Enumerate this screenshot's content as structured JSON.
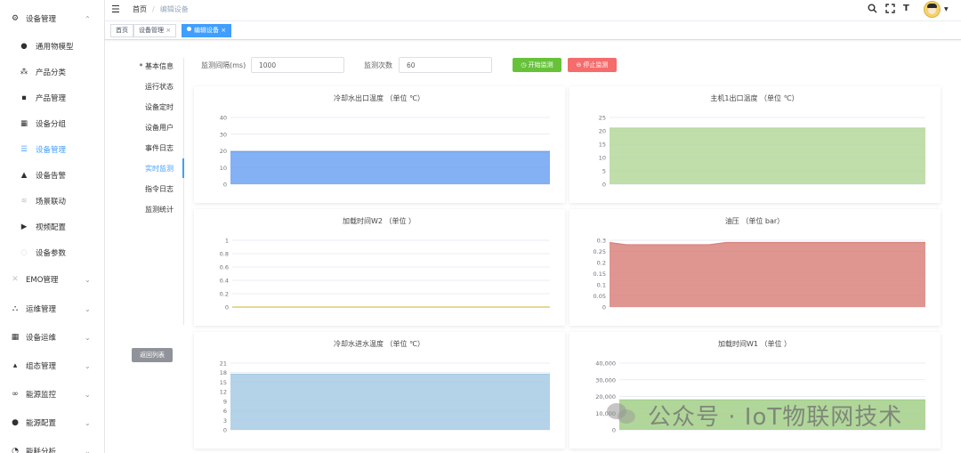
{
  "topbar": {
    "breadcrumb": [
      "首页",
      "编辑设备"
    ],
    "font_size_icon_label": "T"
  },
  "sidebar": {
    "groups": [
      {
        "label": "设备管理",
        "icon": "gear-icon",
        "expanded": true
      },
      {
        "label": "EMO管理",
        "icon": "close-icon"
      },
      {
        "label": "运维管理",
        "icon": "tree-icon"
      },
      {
        "label": "设备运维",
        "icon": "table-icon"
      },
      {
        "label": "组态管理",
        "icon": "lock-icon"
      },
      {
        "label": "能源监控",
        "icon": "link-icon"
      },
      {
        "label": "能源配置",
        "icon": "circle-icon"
      },
      {
        "label": "能耗分析",
        "icon": "chart-icon"
      }
    ],
    "sub_items": [
      {
        "label": "通用物模型",
        "icon": "cube-icon"
      },
      {
        "label": "产品分类",
        "icon": "nodes-icon"
      },
      {
        "label": "产品管理",
        "icon": "grid-icon"
      },
      {
        "label": "设备分组",
        "icon": "table-icon"
      },
      {
        "label": "设备管理",
        "icon": "list-icon",
        "active": true
      },
      {
        "label": "设备告警",
        "icon": "bell-icon"
      },
      {
        "label": "场景联动",
        "icon": "scene-icon"
      },
      {
        "label": "视频配置",
        "icon": "video-icon"
      },
      {
        "label": "设备参数",
        "icon": "param-icon"
      }
    ]
  },
  "tags": [
    {
      "label": "首页"
    },
    {
      "label": "设备管理"
    },
    {
      "label": "编辑设备",
      "active": true
    }
  ],
  "inner_tabs": [
    {
      "label": "* 基本信息"
    },
    {
      "label": "运行状态"
    },
    {
      "label": "设备定时"
    },
    {
      "label": "设备用户"
    },
    {
      "label": "事件日志"
    },
    {
      "label": "实时监测",
      "active": true
    },
    {
      "label": "指令日志"
    },
    {
      "label": "监测统计"
    }
  ],
  "back_button": "返回列表",
  "controls": {
    "interval_label": "监测间隔(ms)",
    "interval_value": "1000",
    "count_label": "监测次数",
    "count_value": "60",
    "start_label": "开始监测",
    "stop_label": "停止监测"
  },
  "colors": {
    "accent": "#409eff",
    "start": "#67c23a",
    "stop": "#f56c6c"
  },
  "chart_data": [
    {
      "type": "area",
      "title": "冷却水出口温度 （单位 ℃）",
      "ylim": [
        0,
        40
      ],
      "yticks": [
        "0",
        "10",
        "20",
        "30",
        "40"
      ],
      "series": [
        {
          "values": [
            19.5,
            19.5
          ]
        }
      ],
      "color": "#6fa2f2"
    },
    {
      "type": "area",
      "title": "主机1出口温度 （单位 ℃）",
      "ylim": [
        0,
        25
      ],
      "yticks": [
        "0",
        "5",
        "10",
        "15",
        "20",
        "25"
      ],
      "series": [
        {
          "values": [
            21,
            21
          ]
        }
      ],
      "color": "#b5d89b"
    },
    {
      "type": "line",
      "title": "加载时间W2 （单位 ）",
      "ylim": [
        0,
        1
      ],
      "yticks": [
        "0",
        "0.2",
        "0.4",
        "0.6",
        "0.8",
        "1"
      ],
      "series": [
        {
          "values": [
            0,
            0
          ]
        }
      ],
      "color": "#d4c15a"
    },
    {
      "type": "area",
      "title": "油压 （单位 bar）",
      "ylim": [
        0,
        0.3
      ],
      "yticks": [
        "0",
        "0.05",
        "0.1",
        "0.15",
        "0.2",
        "0.25",
        "0.3"
      ],
      "series": [
        {
          "values": [
            0.29,
            0.28,
            0.28,
            0.28,
            0.28,
            0.28,
            0.28,
            0.29,
            0.29,
            0.29,
            0.29,
            0.29,
            0.29,
            0.29,
            0.29,
            0.29,
            0.29,
            0.29,
            0.29,
            0.29
          ]
        }
      ],
      "color": "#d9837d"
    },
    {
      "type": "area",
      "title": "冷却水进水温度 （单位 ℃）",
      "ylim": [
        0,
        21
      ],
      "yticks": [
        "0",
        "3",
        "6",
        "9",
        "12",
        "15",
        "18",
        "21"
      ],
      "series": [
        {
          "values": [
            17.5,
            17.5
          ]
        }
      ],
      "color": "#a7cbe4"
    },
    {
      "type": "area",
      "title": "加载时间W1 （单位 ）",
      "ylim": [
        0,
        40000
      ],
      "yticks": [
        "0",
        "10,000",
        "20,000",
        "30,000",
        "40,000"
      ],
      "series": [
        {
          "values": [
            18000,
            18000
          ]
        }
      ],
      "color": "#a3cf88"
    }
  ],
  "watermark": "公众号 · IoT物联网技术"
}
